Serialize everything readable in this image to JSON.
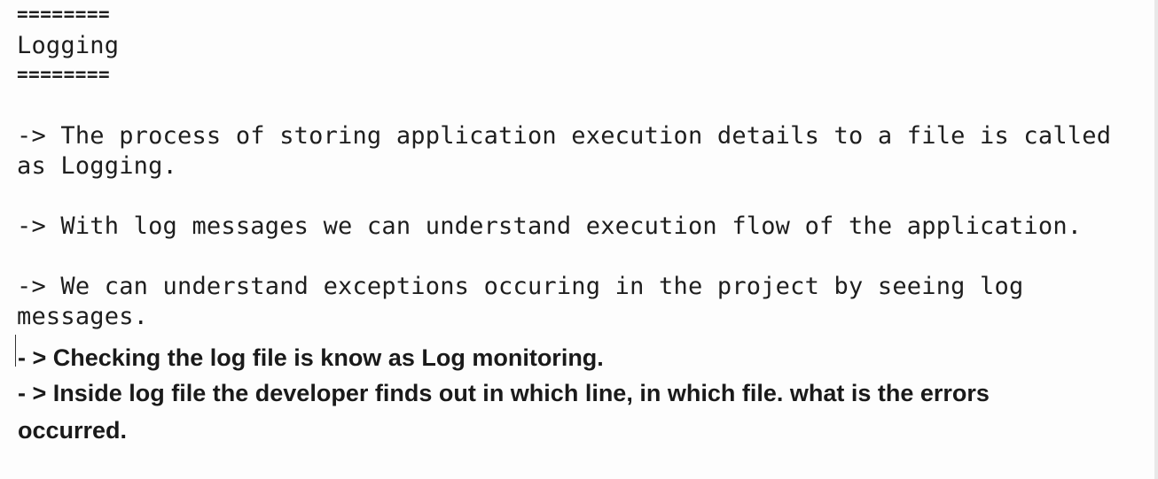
{
  "document": {
    "rule_top": "========",
    "heading": "Logging",
    "rule_bottom": "========",
    "mono_lines": [
      "-> The process of storing application execution details to a file is called",
      "as Logging.",
      "-> With log messages we can understand execution flow of the application.",
      "-> We can understand exceptions occuring in the project by seeing log",
      "messages."
    ],
    "bold_lines": [
      "- > Checking the log file is know as Log monitoring.",
      "- > Inside log file the developer finds out in which line, in which file. what is the errors",
      "occurred."
    ]
  }
}
